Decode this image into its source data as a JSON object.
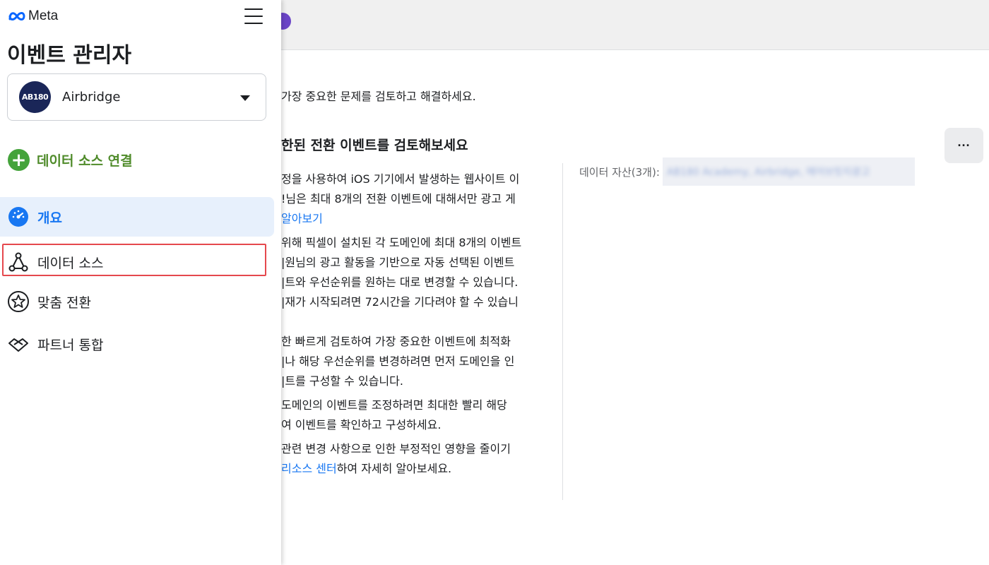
{
  "colors": {
    "accent": "#1877f2",
    "connect_green": "#44a33b",
    "connect_label": "#4f8b2a",
    "highlight_box": "#e5484d",
    "active_nav_bg": "#e7f0fc"
  },
  "sidebar": {
    "logo_text": "Meta",
    "menu_icon": "hamburger-icon",
    "title": "이벤트 관리자",
    "account": {
      "avatar_text": "AB180",
      "name": "Airbridge",
      "caret_icon": "caret-down-icon"
    },
    "connect_button": {
      "icon": "plus-circle-icon",
      "label": "데이터 소스 연결"
    },
    "nav": [
      {
        "id": "overview",
        "label": "개요",
        "icon": "speedometer-icon",
        "active": true
      },
      {
        "id": "data-sources",
        "label": "데이터 소스",
        "icon": "network-nodes-icon",
        "highlighted": true
      },
      {
        "id": "custom-conversions",
        "label": "맞춤 전환",
        "icon": "star-badge-icon"
      },
      {
        "id": "partner-integrations",
        "label": "파트너 통합",
        "icon": "handshake-icon"
      }
    ]
  },
  "main": {
    "intro": "가장 중요한 문제를 검토하고 해결하세요.",
    "section_title": "한된 전환 이벤트를 검토해보세요",
    "more_label": "···",
    "paragraphs": [
      [
        "정을 사용하여 iOS 기기에서 발생하는 웹사이트 이",
        "!님은 최대 8개의 전환 이벤트에 대해서만 광고 게"
      ],
      [
        "위해 픽셀이 설치된 각 도메인에 최대 8개의 이벤트",
        "|원님의 광고 활동을 기반으로 자동 선택된 이벤트",
        "|트와 우선순위를 원하는 대로 변경할 수 있습니다.",
        "|재가 시작되려면 72시간을 기다려야 할 수 있습니"
      ],
      [
        "한 빠르게 검토하여 가장 중요한 이벤트에 최적화",
        "|나 해당 우선순위를 변경하려면 먼저 도메인을 인",
        "|트를 구성할 수 있습니다."
      ],
      [
        " 도메인의 이벤트를 조정하려면 최대한 빨리 해당",
        "여 이벤트를 확인하고 구성하세요."
      ],
      [
        " 관련 변경 사항으로 인한 부정적인 영향을 줄이기"
      ]
    ],
    "learn_more_link": "알아보기",
    "resource_link": "리소스 센터",
    "resource_suffix": "하여 자세히 알아보세요.",
    "assets_label": "데이터 자산(3개):",
    "assets_value": "AB180 Academy, Airbridge, 에어브릿지광고"
  }
}
